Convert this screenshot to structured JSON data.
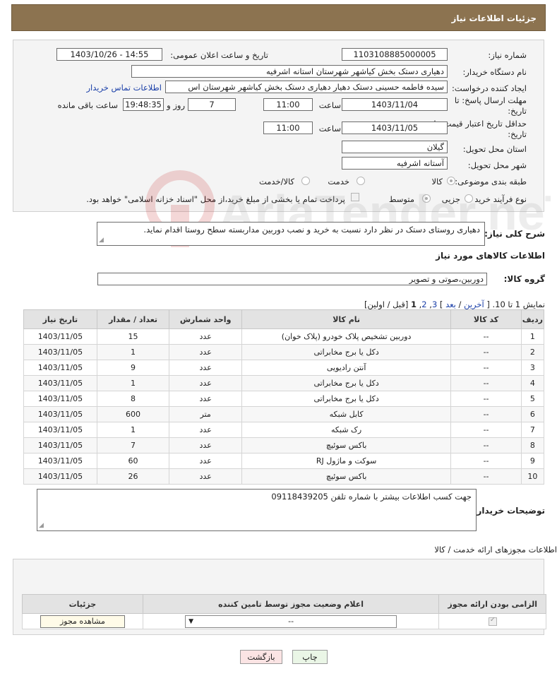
{
  "header": {
    "title": "جزئیات اطلاعات نیاز"
  },
  "form": {
    "need_number_label": "شماره نیاز:",
    "need_number": "1103108885000005",
    "announce_label": "تاریخ و ساعت اعلان عمومی:",
    "announce_value": "1403/10/26 - 14:55",
    "buyer_org_label": "نام دستگاه خریدار:",
    "buyer_org": "دهیاری دستک بخش کیاشهر شهرستان استانه اشرفیه",
    "creator_label": "ایجاد کننده درخواست:",
    "creator": "سیده فاطمه حسینی دستک دهیار دهیاری دستک بخش کیاشهر شهرستان اس",
    "contact_link": "اطلاعات تماس خریدار",
    "reply_deadline_label": "مهلت ارسال پاسخ: تا تاریخ:",
    "reply_date": "1403/11/04",
    "time_label": "ساعت",
    "reply_time": "11:00",
    "days": "7",
    "days_label": "روز و",
    "remaining": "19:48:35",
    "remaining_label": "ساعت باقی مانده",
    "validity_label": "حداقل تاریخ اعتبار قیمت: تا تاریخ:",
    "validity_date": "1403/11/05",
    "validity_time": "11:00",
    "province_label": "استان محل تحویل:",
    "province": "گیلان",
    "city_label": "شهر محل تحویل:",
    "city": "آستانه اشرفیه",
    "category_label": "طبقه بندی موضوعی:",
    "cat_goods": "کالا",
    "cat_service": "خدمت",
    "cat_goods_service": "کالا/خدمت",
    "process_label": "نوع فرآیند خرید :",
    "proc_minor": "جزیی",
    "proc_medium": "متوسط",
    "payment_note": "پرداخت تمام یا بخشی از مبلغ خرید،از محل \"اسناد خزانه اسلامی\" خواهد بود."
  },
  "summary": {
    "label": "شرح کلی نیاز:",
    "text": "دهیاری روستای دستک در نظر دارد نسبت به خرید و نصب دوربین مداربسته سطح روستا اقدام نماید."
  },
  "goods": {
    "section_title": "اطلاعات کالاهای مورد نیاز",
    "group_label": "گروه کالا:",
    "group_value": "دوربین،صوتی و تصویر",
    "pager_prefix": "نمایش 1 تا 10. [",
    "pager_last": "آخرین",
    "pager_sep": "/",
    "pager_next": "بعد",
    "pager_pages_open": "] ",
    "pager_p3": "3",
    "pager_p2": "2",
    "pager_p1": "1",
    "pager_suffix": " [قبل / اولین]",
    "columns": [
      "ردیف",
      "کد کالا",
      "نام کالا",
      "واحد شمارش",
      "تعداد / مقدار",
      "تاریخ نیاز"
    ],
    "rows": [
      [
        "1",
        "--",
        "دوربین تشخیص پلاک خودرو (پلاک خوان)",
        "عدد",
        "15",
        "1403/11/05"
      ],
      [
        "2",
        "--",
        "دکل یا برج مخابراتی",
        "عدد",
        "1",
        "1403/11/05"
      ],
      [
        "3",
        "--",
        "آنتن رادیویی",
        "عدد",
        "9",
        "1403/11/05"
      ],
      [
        "4",
        "--",
        "دکل یا برج مخابراتی",
        "عدد",
        "1",
        "1403/11/05"
      ],
      [
        "5",
        "--",
        "دکل یا برج مخابراتی",
        "عدد",
        "8",
        "1403/11/05"
      ],
      [
        "6",
        "--",
        "کابل شبکه",
        "متر",
        "600",
        "1403/11/05"
      ],
      [
        "7",
        "--",
        "رک شبکه",
        "عدد",
        "1",
        "1403/11/05"
      ],
      [
        "8",
        "--",
        "باکس سوئیچ",
        "عدد",
        "7",
        "1403/11/05"
      ],
      [
        "9",
        "--",
        "سوکت و ماژول RJ",
        "عدد",
        "60",
        "1403/11/05"
      ],
      [
        "10",
        "--",
        "باکس سوئیچ",
        "عدد",
        "26",
        "1403/11/05"
      ]
    ]
  },
  "buyer_notes": {
    "label": "توضیحات خریدار:",
    "text": "جهت کسب اطلاعات بیشتر با شماره تلفن 09118439205"
  },
  "permits": {
    "title": "اطلاعات مجوزهای ارائه خدمت / کالا",
    "columns": [
      "الزامی بودن ارائه مجوز",
      "اعلام وضعیت مجوز توسط تامین کننده",
      "جزئیات"
    ],
    "select_value": "--",
    "view_button": "مشاهده مجوز"
  },
  "actions": {
    "print": "چاپ",
    "back": "بازگشت"
  },
  "watermark_text": "AriaTender.neT"
}
